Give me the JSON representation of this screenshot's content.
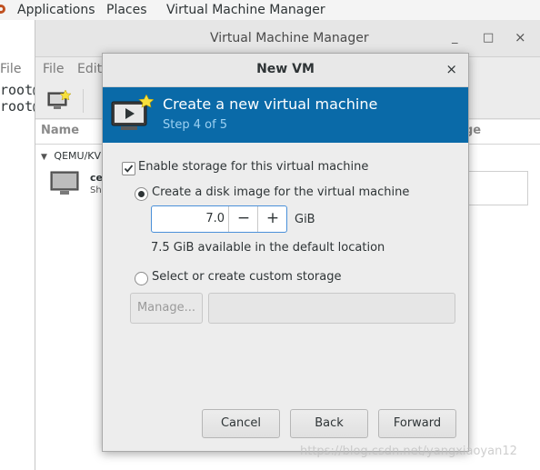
{
  "top_panel": {
    "applications": "Applications",
    "places": "Places",
    "app_menu": "Virtual Machine Manager"
  },
  "terminal": {
    "menu_file": "File",
    "lines": [
      "root@",
      "root@"
    ]
  },
  "vmm_window": {
    "title": "Virtual Machine Manager",
    "minimize": "_",
    "maximize": "□",
    "close": "×",
    "menu_file": "File",
    "menu_edit": "Edit",
    "col_name": "Name",
    "col_usage": "ge",
    "group": "QEMU/KV",
    "vm_name": "ce",
    "vm_state": "Sh"
  },
  "dialog": {
    "title": "New VM",
    "close": "×",
    "header_title": "Create a new virtual machine",
    "header_step": "Step 4 of 5",
    "enable_storage": "Enable storage for this virtual machine",
    "enable_storage_checked": true,
    "create_disk": "Create a disk image for the virtual machine",
    "create_disk_selected": true,
    "size_value": "7.0",
    "size_minus": "−",
    "size_plus": "+",
    "size_unit": "GiB",
    "available": "7.5 GiB available in the default location",
    "custom_storage": "Select or create custom storage",
    "custom_storage_selected": false,
    "manage_button": "Manage...",
    "storage_path": "",
    "cancel_button": "Cancel",
    "back_button": "Back",
    "forward_button": "Forward"
  },
  "colors": {
    "header_bg": "#0a6aa8",
    "header_step": "#9cd1f2",
    "focus_border": "#4a90d9"
  },
  "watermark": "https://blog.csdn.net/yangxiaoyan12"
}
